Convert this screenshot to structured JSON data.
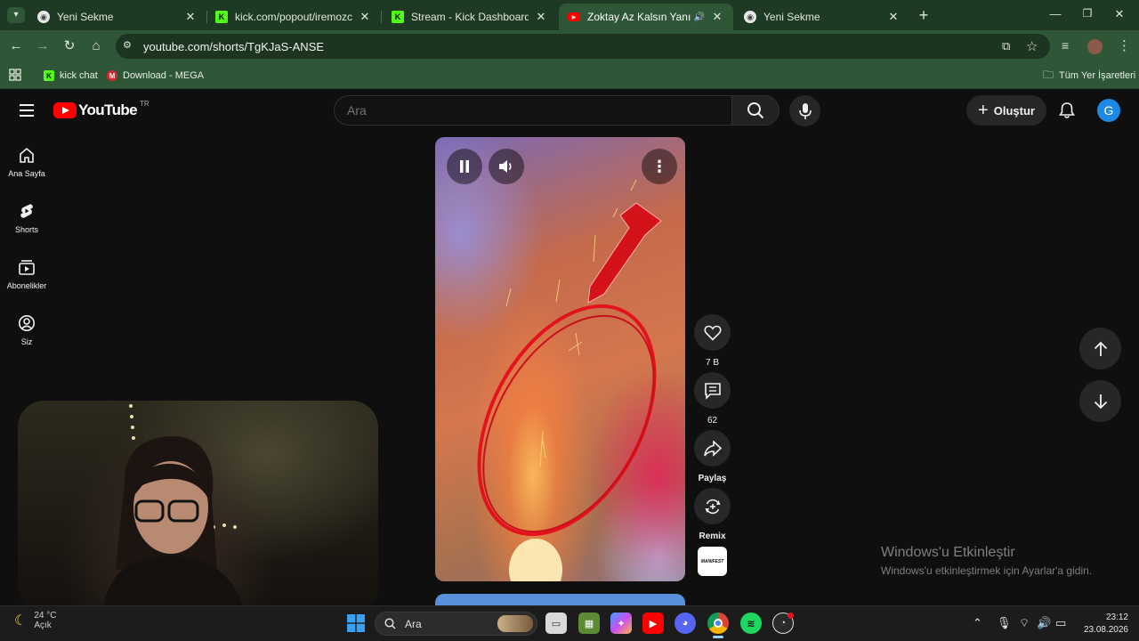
{
  "browser": {
    "tabs": [
      {
        "title": "Yeni Sekme",
        "favicon": "chrome-icon"
      },
      {
        "title": "kick.com/popout/iremozceritt/ch",
        "favicon": "kick-icon"
      },
      {
        "title": "Stream - Kick Dashboard",
        "favicon": "kick-icon"
      },
      {
        "title": "Zoktay Az Kalsın Yanıyordu🔥",
        "favicon": "youtube-icon",
        "active": true
      },
      {
        "title": "Yeni Sekme",
        "favicon": "chrome-icon"
      }
    ],
    "new_tab": "+",
    "url": "youtube.com/shorts/TgKJaS-ANSE",
    "bookmarks": [
      {
        "label": "kick chat",
        "favicon": "kick-icon"
      },
      {
        "label": "Download - MEGA",
        "favicon": "mega-icon"
      }
    ],
    "all_bookmarks": "Tüm Yer İşaretleri"
  },
  "youtube": {
    "logo_text": "YouTube",
    "region": "TR",
    "search_placeholder": "Ara",
    "create_label": "Oluştur",
    "avatar_letter": "G",
    "sidebar": [
      {
        "label": "Ana Sayfa",
        "icon": "home-icon"
      },
      {
        "label": "Shorts",
        "icon": "shorts-icon"
      },
      {
        "label": "Abonelikler",
        "icon": "subscriptions-icon"
      },
      {
        "label": "Siz",
        "icon": "user-icon"
      }
    ],
    "actions": {
      "likes": "7 B",
      "comments": "62",
      "share": "Paylaş",
      "remix": "Remix",
      "channel_badge": "MANIFEST"
    }
  },
  "windows": {
    "activation_title": "Windows'u Etkinleştir",
    "activation_subtitle": "Windows'u etkinleştirmek için Ayarlar'a gidin.",
    "weather_temp": "24 °C",
    "weather_text": "Açık",
    "search_placeholder": "Ara",
    "time": "23:12",
    "date": "23.08.2026"
  },
  "colors": {
    "browser_frame": "#1f3a24",
    "youtube_red": "#ff0000",
    "avatar_blue": "#1e88e5"
  }
}
